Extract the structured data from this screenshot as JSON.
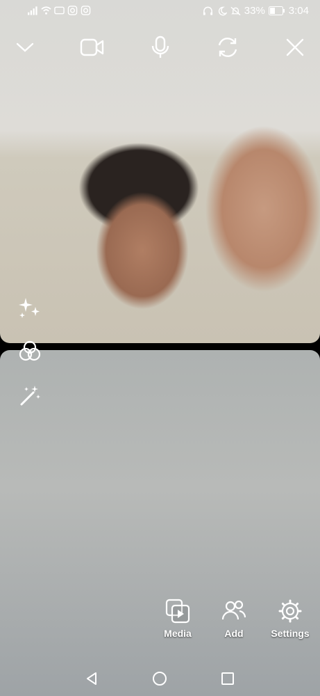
{
  "status_bar": {
    "battery_percent": "33%",
    "time": "3:04",
    "icons_left": [
      "signal-icon",
      "wifi-icon",
      "video-notification-icon",
      "instagram-icon",
      "instagram-icon"
    ],
    "icons_right": [
      "headphones-icon",
      "moon-icon",
      "mute-icon",
      "battery-icon"
    ]
  },
  "call_controls": [
    "chevron-down-icon",
    "video-camera-icon",
    "microphone-icon",
    "switch-camera-icon",
    "close-icon"
  ],
  "side_tools": [
    "sparkles-effects-icon",
    "filter-circles-icon",
    "magic-wand-icon"
  ],
  "actions": {
    "media_label": "Media",
    "add_label": "Add",
    "settings_label": "Settings"
  },
  "nav": [
    "back-icon",
    "home-icon",
    "recents-icon"
  ],
  "colors": {
    "icon": "#ffffff",
    "backdrop": "#000000"
  }
}
